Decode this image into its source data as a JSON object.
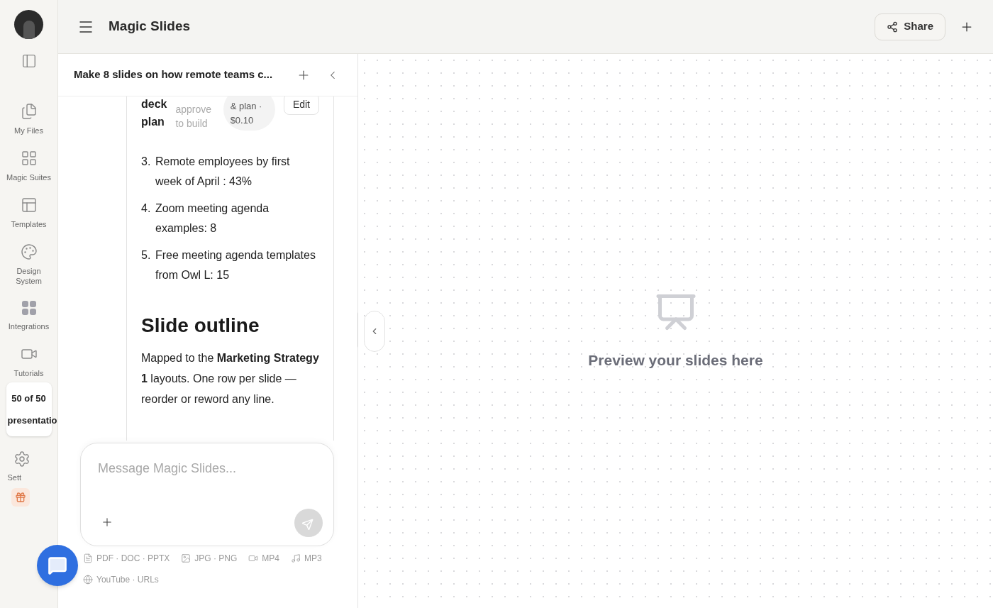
{
  "app": {
    "title": "Magic Slides"
  },
  "header_actions": {
    "share": "Share"
  },
  "rail": {
    "items": [
      {
        "kind": "files",
        "label": "My Files"
      },
      {
        "kind": "suites",
        "label": "Magic Suites"
      },
      {
        "kind": "templates",
        "label": "Templates"
      },
      {
        "kind": "design",
        "label": "Design System"
      },
      {
        "kind": "integrations",
        "label": "Integrations"
      },
      {
        "kind": "tutorials",
        "label": "Tutorials"
      }
    ],
    "usage": {
      "count": "50 of 50",
      "unit": "presentatio"
    },
    "settings_label": "Sett"
  },
  "chat": {
    "title": "Make 8 slides on how remote teams c...",
    "plan_card": {
      "title": "deck plan",
      "note": "approve to build",
      "cost": "& plan · $0.10",
      "edit": "Edit"
    },
    "list": [
      {
        "number": "3.",
        "text": "Remote employees by first week of April : 43%"
      },
      {
        "number": "4.",
        "text": "Zoom meeting agenda examples: 8"
      },
      {
        "number": "5.",
        "text": "Free meeting agenda templates from Owl L: 15"
      }
    ],
    "heading": "Slide outline",
    "paragraph": "Mapped to the **Marketing Strategy 1** layouts. One row per slide — reorder or reword any line."
  },
  "composer": {
    "placeholder": "Message Magic Slides...",
    "attachments": [
      {
        "kind": "document",
        "label": "PDF · DOC · PPTX"
      },
      {
        "kind": "image",
        "label": "JPG · PNG"
      },
      {
        "kind": "video",
        "label": "MP4"
      },
      {
        "kind": "audio",
        "label": "MP3"
      },
      {
        "kind": "web",
        "label": "YouTube · URLs"
      }
    ]
  },
  "preview": {
    "message": "Preview your slides here"
  }
}
